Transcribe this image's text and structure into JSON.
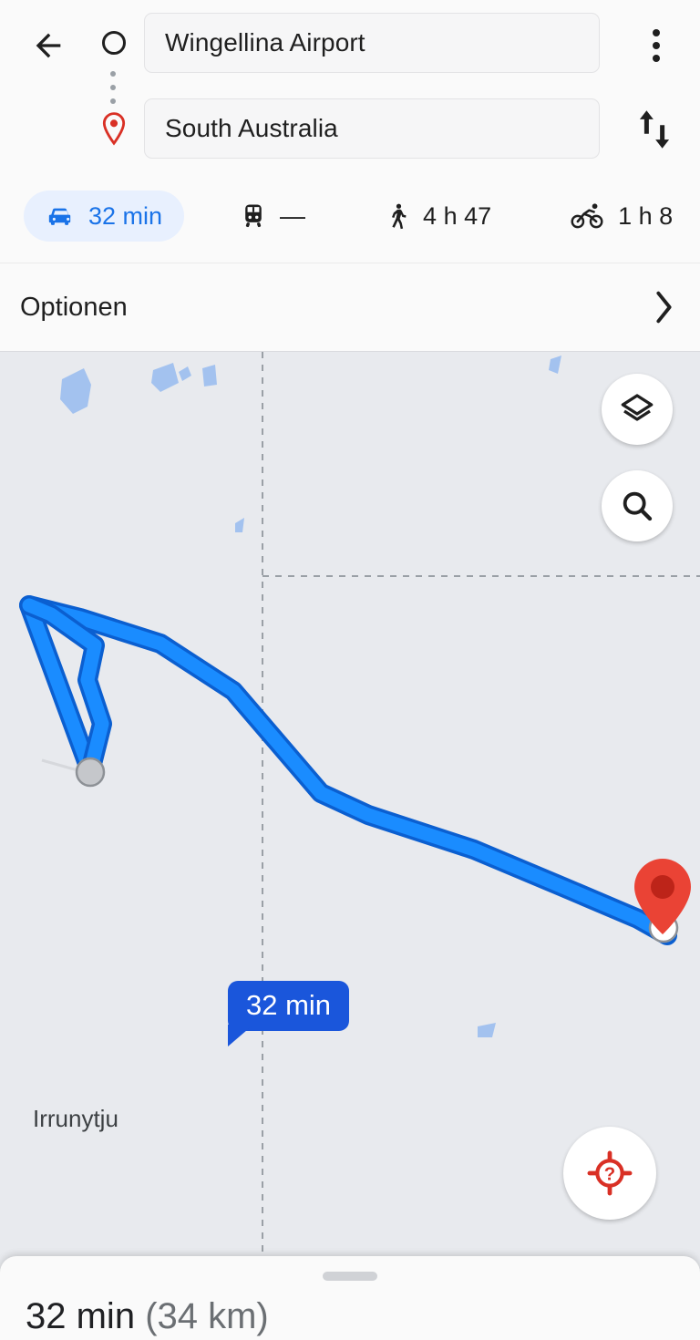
{
  "header": {
    "back_icon": "arrow-left-icon",
    "overflow_icon": "more-vert-icon",
    "swap_icon": "swap-vertical-icon",
    "origin_icon": "circle-outline-icon",
    "destination_icon": "map-pin-icon",
    "origin": {
      "value": "Wingellina Airport",
      "placeholder": "Startpunkt"
    },
    "destination": {
      "value": "South Australia",
      "placeholder": "Ziel"
    }
  },
  "modes": [
    {
      "id": "driving",
      "icon": "car-icon",
      "label": "32 min",
      "active": true
    },
    {
      "id": "transit",
      "icon": "train-icon",
      "label": "—",
      "active": false
    },
    {
      "id": "walking",
      "icon": "walk-icon",
      "label": "4 h 47",
      "active": false
    },
    {
      "id": "cycling",
      "icon": "bicycle-icon",
      "label": "1 h 8",
      "active": false
    }
  ],
  "options_row": {
    "label": "Optionen",
    "chevron_icon": "chevron-right-icon"
  },
  "map": {
    "background_color": "#e8eaee",
    "water_color": "#a3c2ef",
    "route_color": "#1a8cff",
    "route_outline_color": "#0b5fd0",
    "boundary_color": "#9aa0a6",
    "eta_badge": {
      "label": "32 min",
      "color": "#1a56db"
    },
    "place_label": "Irrunytju",
    "origin_marker": "circle-marker",
    "destination_marker": "red-pin-marker",
    "controls": [
      {
        "id": "layers",
        "icon": "layers-icon"
      },
      {
        "id": "search",
        "icon": "search-icon"
      },
      {
        "id": "locate",
        "icon": "location-unknown-icon",
        "color": "#d93025"
      }
    ]
  },
  "sheet": {
    "handle": "drag-handle",
    "duration": "32 min",
    "distance": "(34 km)"
  },
  "colors": {
    "accent_blue": "#1a73e8",
    "chip_bg": "#e8f0fe",
    "red": "#d93025",
    "text": "#1f1f1f"
  }
}
